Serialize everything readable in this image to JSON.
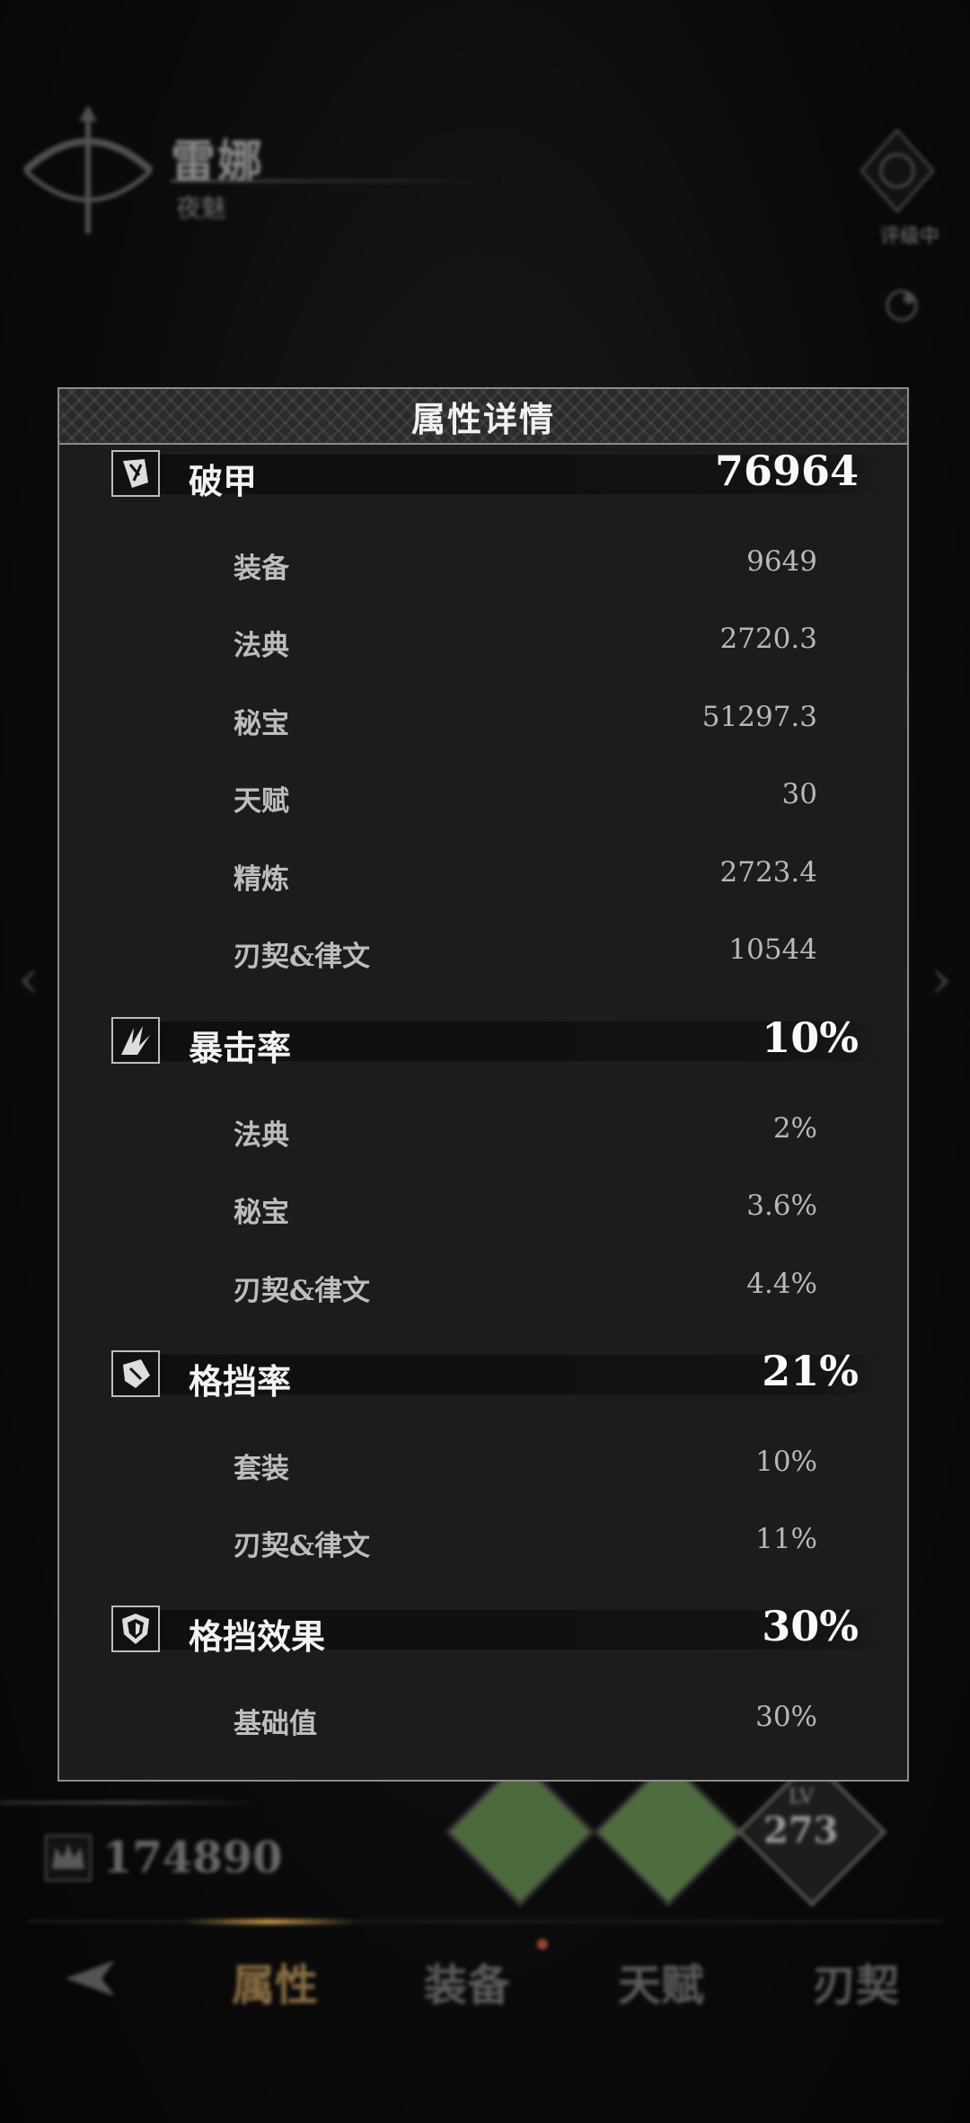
{
  "background": {
    "character": {
      "name": "雷娜",
      "subtitle": "夜魅"
    },
    "rank_label": "评级中",
    "power_value": "174890",
    "level": {
      "label": "LV",
      "value": "273"
    },
    "tabs": [
      {
        "label": "属性",
        "active": true
      },
      {
        "label": "装备",
        "active": false
      },
      {
        "label": "天赋",
        "active": false
      },
      {
        "label": "刃契",
        "active": false
      }
    ]
  },
  "modal": {
    "title": "属性详情",
    "stats": [
      {
        "icon": "armor-break-icon",
        "name": "破甲",
        "total": "76964",
        "rows": [
          {
            "label": "装备",
            "value": "9649"
          },
          {
            "label": "法典",
            "value": "2720.3"
          },
          {
            "label": "秘宝",
            "value": "51297.3"
          },
          {
            "label": "天赋",
            "value": "30"
          },
          {
            "label": "精炼",
            "value": "2723.4"
          },
          {
            "label": "刃契&律文",
            "value": "10544"
          }
        ]
      },
      {
        "icon": "crit-rate-icon",
        "name": "暴击率",
        "total": "10%",
        "rows": [
          {
            "label": "法典",
            "value": "2%"
          },
          {
            "label": "秘宝",
            "value": "3.6%"
          },
          {
            "label": "刃契&律文",
            "value": "4.4%"
          }
        ]
      },
      {
        "icon": "block-rate-icon",
        "name": "格挡率",
        "total": "21%",
        "rows": [
          {
            "label": "套装",
            "value": "10%"
          },
          {
            "label": "刃契&律文",
            "value": "11%"
          }
        ]
      },
      {
        "icon": "block-effect-icon",
        "name": "格挡效果",
        "total": "30%",
        "rows": [
          {
            "label": "基础值",
            "value": "30%"
          }
        ]
      }
    ]
  }
}
